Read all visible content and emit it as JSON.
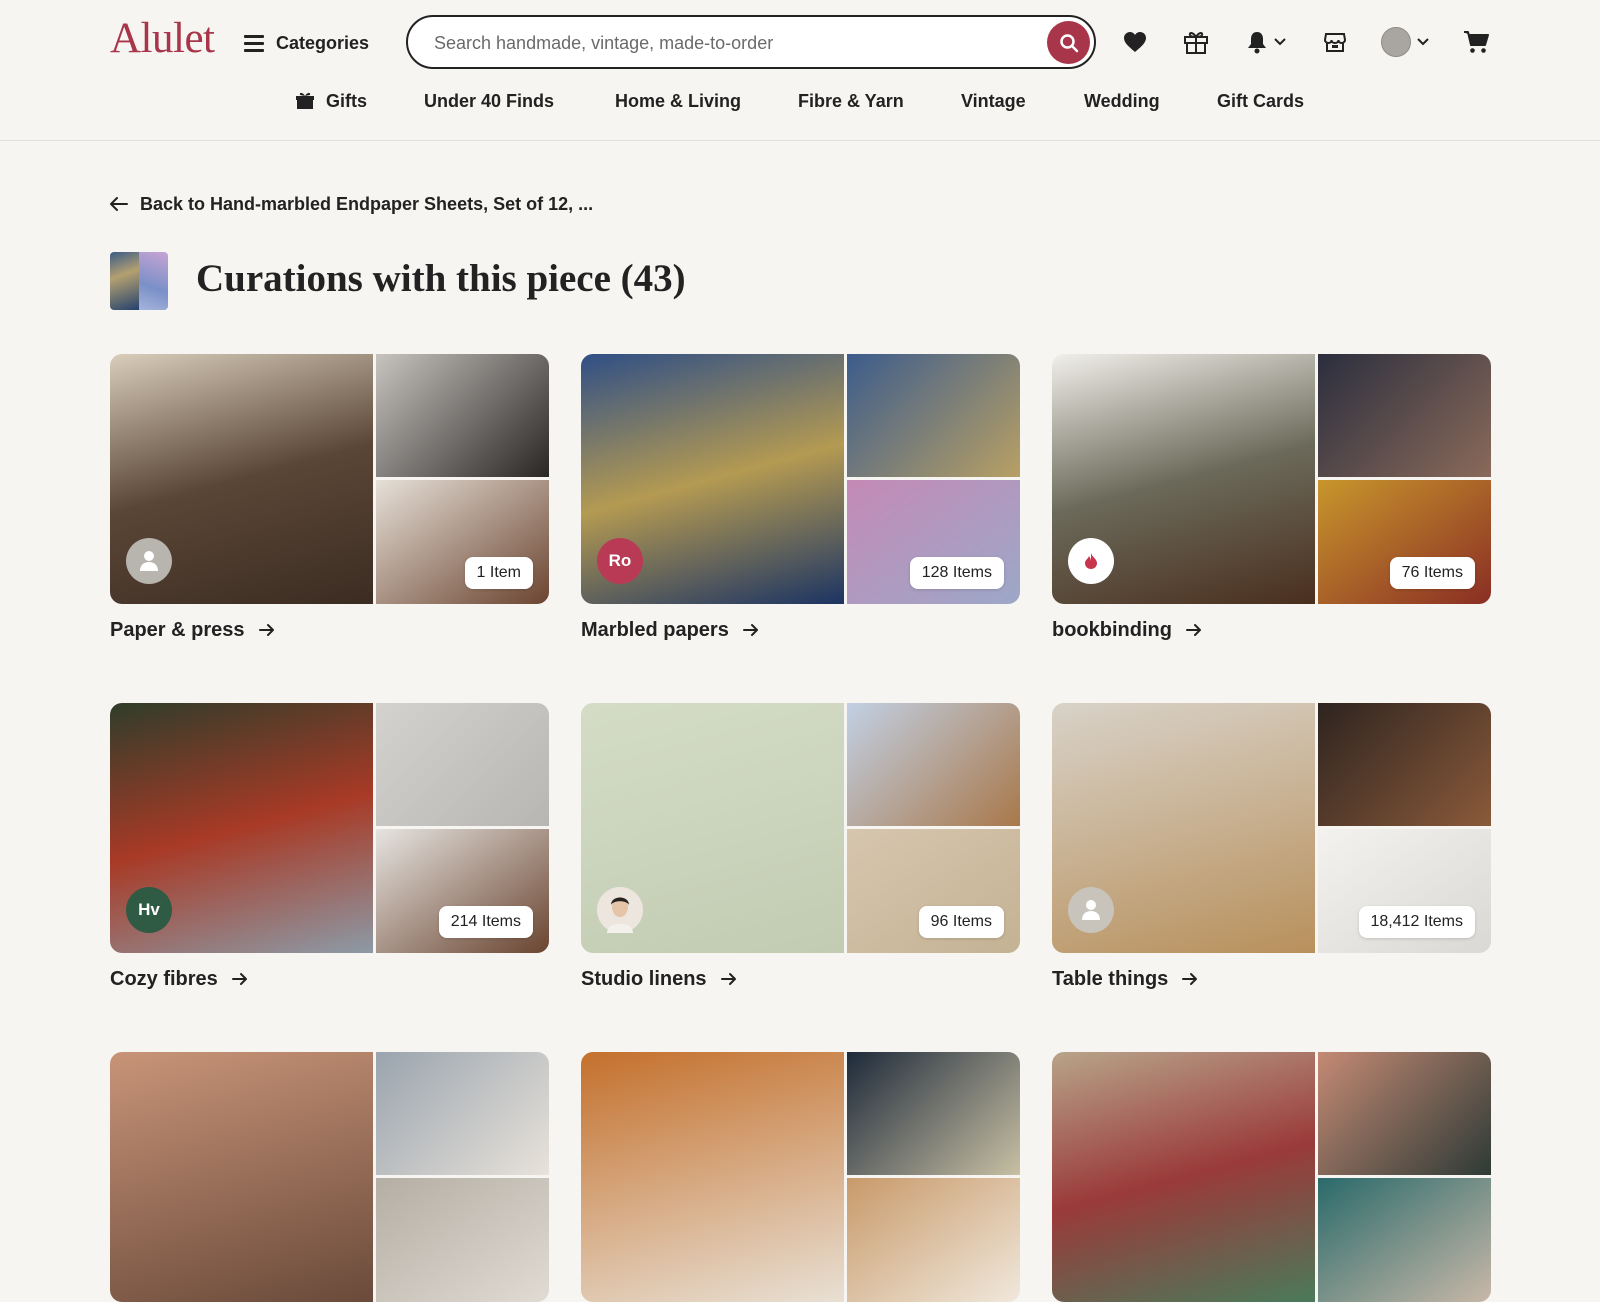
{
  "brand": {
    "name": "Alulet",
    "accent_color": "#a8354a"
  },
  "header": {
    "categories_label": "Categories",
    "search_placeholder": "Search handmade, vintage, made-to-order",
    "icons": [
      "heart-icon",
      "gift-icon",
      "bell-icon",
      "shop-icon",
      "avatar",
      "cart-icon"
    ]
  },
  "nav": {
    "items": [
      {
        "label": "Gifts",
        "icon": "gift-box-icon"
      },
      {
        "label": "Under 40 Finds"
      },
      {
        "label": "Home & Living"
      },
      {
        "label": "Fibre & Yarn"
      },
      {
        "label": "Vintage"
      },
      {
        "label": "Wedding"
      },
      {
        "label": "Gift Cards"
      }
    ]
  },
  "page": {
    "back_label": "Back to Hand-marbled Endpaper Sheets, Set of 12, ...",
    "title": "Curations with this piece (43)"
  },
  "collections": [
    {
      "title": "Paper & press",
      "count": "1 Item",
      "curator": {
        "type": "placeholder",
        "color": "#b8b4ae"
      },
      "colors": {
        "main": [
          "#d9cdbb",
          "#5a4636",
          "#3b2c22"
        ],
        "tr": [
          "#c7c4c0",
          "#2a2624"
        ],
        "br": [
          "#e6e0d8",
          "#6b4430"
        ]
      }
    },
    {
      "title": "Marbled papers",
      "count": "128 Items",
      "curator": {
        "type": "initials",
        "initials": "Ro",
        "color": "#b83a54"
      },
      "colors": {
        "main": [
          "#2f4f86",
          "#b49a52",
          "#1c3463"
        ],
        "tr": [
          "#3c5c8c",
          "#b8a064"
        ],
        "br": [
          "#c48ab6",
          "#9ca8c8"
        ]
      }
    },
    {
      "title": "bookbinding",
      "count": "76 Items",
      "curator": {
        "type": "logo",
        "color": "#ffffff"
      },
      "colors": {
        "main": [
          "#f1efea",
          "#6b6a5a",
          "#4a2e1e"
        ],
        "tr": [
          "#2b2e3e",
          "#8a6a5a"
        ],
        "br": [
          "#c8962c",
          "#8a2e24"
        ]
      }
    },
    {
      "title": "Cozy fibres",
      "count": "214 Items",
      "curator": {
        "type": "initials",
        "initials": "Hv",
        "color": "#2f5a44"
      },
      "colors": {
        "main": [
          "#2f3d2a",
          "#a83a26",
          "#8c9aa6"
        ],
        "tr": [
          "#d4d2cf",
          "#b8b6b2"
        ],
        "br": [
          "#e6e4e0",
          "#6a4430"
        ]
      }
    },
    {
      "title": "Studio linens",
      "count": "96 Items",
      "curator": {
        "type": "photo",
        "color": "#e8e2da"
      },
      "colors": {
        "main": [
          "#d4dcc6",
          "#c2ccb2"
        ],
        "tr": [
          "#c2d0e4",
          "#a8784a"
        ],
        "br": [
          "#d6c6ae",
          "#c4b294"
        ]
      }
    },
    {
      "title": "Table things",
      "count": "18,412 Items",
      "curator": {
        "type": "placeholder",
        "color": "#c8c4bc"
      },
      "colors": {
        "main": [
          "#d8d2c8",
          "#b8905c"
        ],
        "tr": [
          "#2e2420",
          "#8a5a3a"
        ],
        "br": [
          "#f4f2ee",
          "#dad8d4"
        ]
      }
    },
    {
      "title": "",
      "count": "",
      "curator": {
        "type": "none"
      },
      "colors": {
        "main": [
          "#c89478",
          "#6a4a3a"
        ],
        "tr": [
          "#9aa4ae",
          "#e8e2da"
        ],
        "br": [
          "#b4aea4",
          "#e0dbd3"
        ]
      }
    },
    {
      "title": "",
      "count": "",
      "curator": {
        "type": "none"
      },
      "colors": {
        "main": [
          "#c4702c",
          "#e8e0d4"
        ],
        "tr": [
          "#1e2a3a",
          "#c8c0a4"
        ],
        "br": [
          "#c89a6a",
          "#f0e8dc"
        ]
      }
    },
    {
      "title": "",
      "count": "",
      "curator": {
        "type": "none"
      },
      "colors": {
        "main": [
          "#b8a48a",
          "#9a3a3a",
          "#4a7a5a"
        ],
        "tr": [
          "#c48a74",
          "#2e3a36"
        ],
        "br": [
          "#2a6a6a",
          "#c8b8a8"
        ]
      }
    }
  ]
}
